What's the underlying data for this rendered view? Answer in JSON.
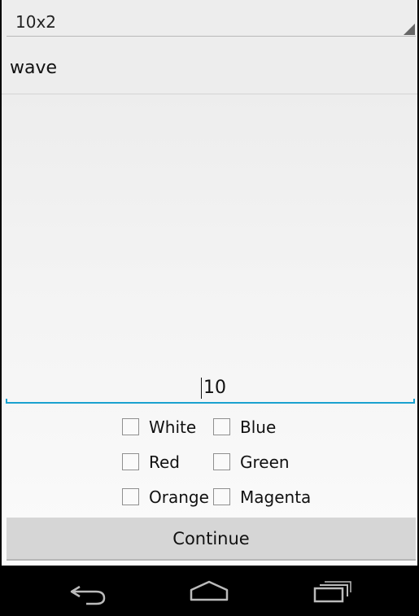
{
  "spinner": {
    "value": "10x2"
  },
  "list": {
    "item": "wave"
  },
  "input": {
    "value": "10"
  },
  "colors": {
    "left": [
      "White",
      "Red",
      "Orange"
    ],
    "right": [
      "Blue",
      "Green",
      "Magenta"
    ]
  },
  "buttons": {
    "continue": "Continue"
  },
  "nav": {
    "back_icon": "back-icon",
    "home_icon": "home-icon",
    "recent_icon": "recent-apps-icon"
  },
  "theme": {
    "accent": "#1aa1cf"
  }
}
